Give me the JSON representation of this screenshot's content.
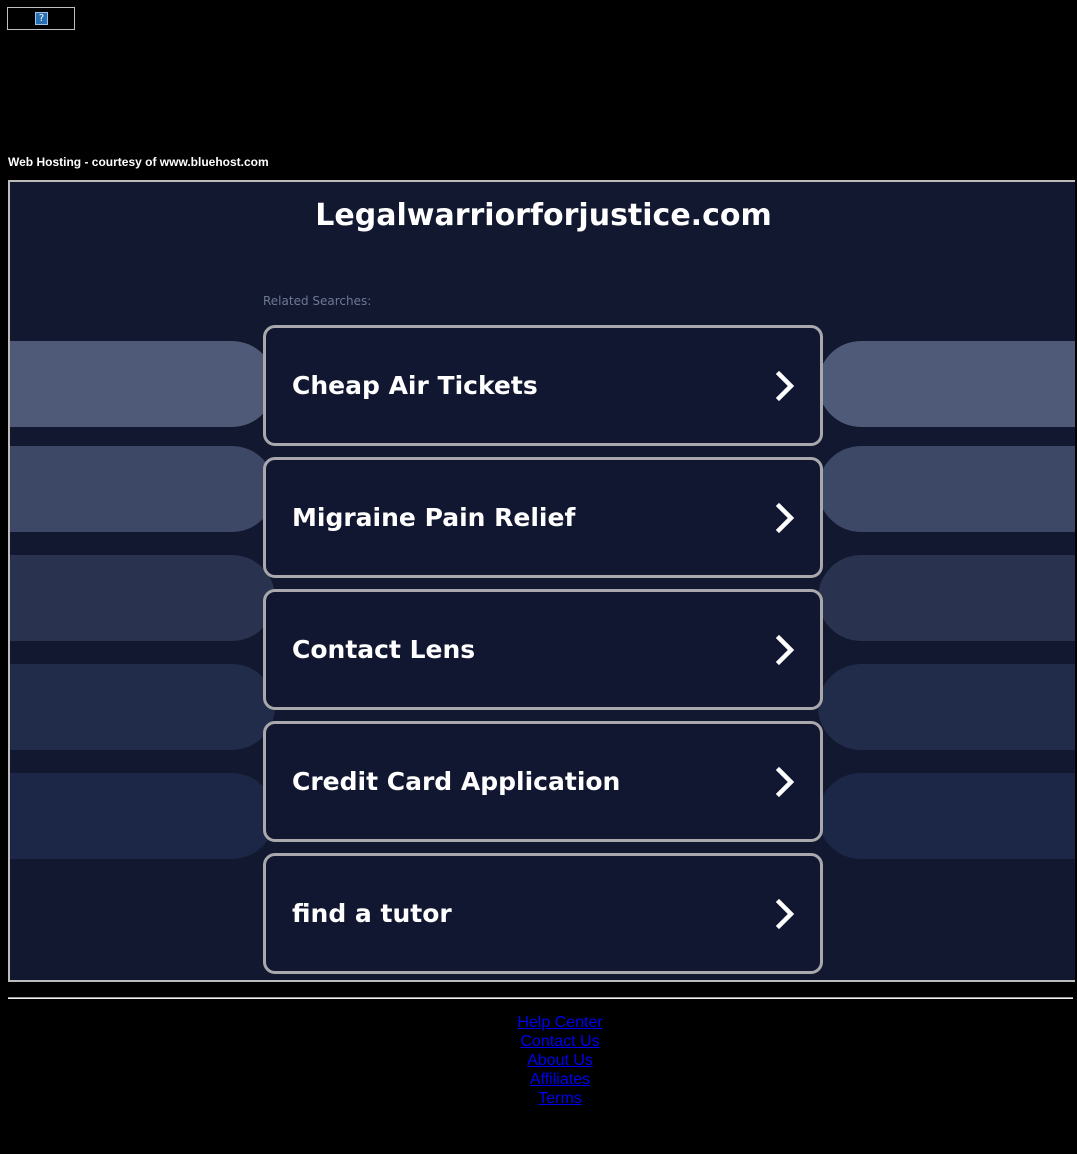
{
  "header": {
    "broken_image_glyph": "?",
    "hosting_credit": "Web Hosting - courtesy of www.bluehost.com"
  },
  "main": {
    "domain": "Legalwarriorforjustice.com",
    "related_label": "Related Searches:",
    "searches": [
      {
        "label": "Cheap Air Tickets"
      },
      {
        "label": "Migraine Pain Relief"
      },
      {
        "label": "Contact Lens"
      },
      {
        "label": "Credit Card Application"
      },
      {
        "label": "find a tutor"
      }
    ]
  },
  "footer": {
    "links": [
      {
        "label": "Help Center"
      },
      {
        "label": "Contact Us"
      },
      {
        "label": "About Us"
      },
      {
        "label": "Affiliates"
      },
      {
        "label": "Terms"
      }
    ]
  },
  "colors": {
    "page_background": "#000000",
    "panel_background": "#111830",
    "card_border": "#a9a9ab",
    "link": "#0000ee",
    "background_pills": [
      "#4e5a77",
      "#3c4866",
      "#29334f",
      "#212b4a",
      "#1c2747"
    ]
  }
}
